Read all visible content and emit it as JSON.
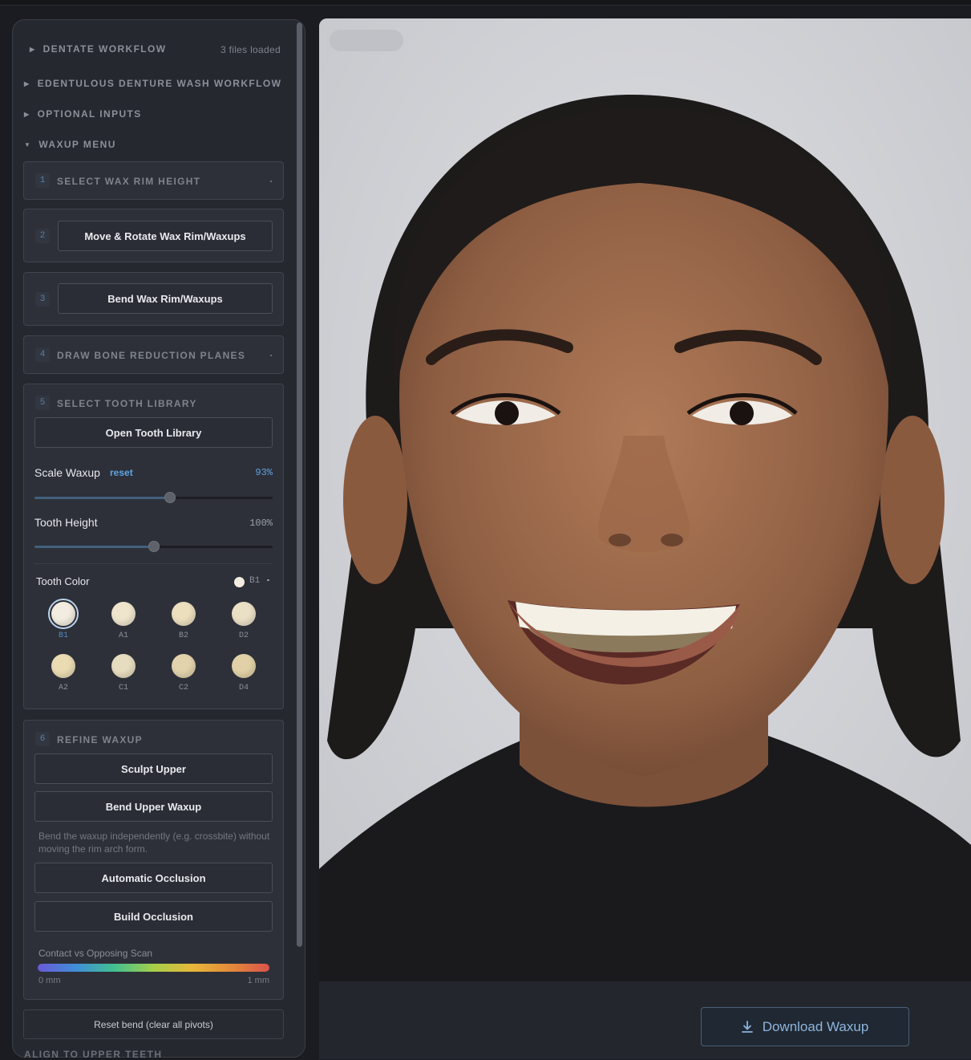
{
  "sidebar": {
    "sections": {
      "dentate": {
        "label": "DENTATE WORKFLOW",
        "meta": "3 files loaded"
      },
      "edentulous": {
        "label": "EDENTULOUS DENTURE WASH WORKFLOW"
      },
      "optional": {
        "label": "OPTIONAL INPUTS"
      },
      "waxup": {
        "label": "WAXUP MENU"
      },
      "align": {
        "label": "ALIGN TO UPPER TEETH"
      }
    },
    "steps": {
      "s1": {
        "num": "1",
        "title": "SELECT WAX RIM HEIGHT"
      },
      "s2": {
        "num": "2",
        "button": "Move & Rotate Wax Rim/Waxups"
      },
      "s3": {
        "num": "3",
        "button": "Bend Wax Rim/Waxups"
      },
      "s4": {
        "num": "4",
        "title": "DRAW BONE REDUCTION PLANES"
      },
      "s5": {
        "num": "5",
        "title": "SELECT TOOTH LIBRARY",
        "button": "Open Tooth Library",
        "scale_label": "Scale Waxup",
        "scale_reset": "reset",
        "scale_value": "93%",
        "scale_fraction": 0.57,
        "height_label": "Tooth Height",
        "height_value": "100%",
        "height_fraction": 0.5,
        "color_label": "Tooth Color",
        "color_selected": "B1",
        "swatches": [
          {
            "label": "B1",
            "color": "#f3ece0"
          },
          {
            "label": "A1",
            "color": "#efe5cd"
          },
          {
            "label": "B2",
            "color": "#ecdfbe"
          },
          {
            "label": "D2",
            "color": "#eae0c6"
          },
          {
            "label": "A2",
            "color": "#eadbb3"
          },
          {
            "label": "C1",
            "color": "#e6dcbf"
          },
          {
            "label": "C2",
            "color": "#e2d3ad"
          },
          {
            "label": "D4",
            "color": "#e2d1a8"
          }
        ]
      },
      "s6": {
        "num": "6",
        "title": "REFINE WAXUP",
        "sculpt": "Sculpt Upper",
        "bend_upper": "Bend Upper Waxup",
        "hint": "Bend the waxup independently (e.g. crossbite) without moving the rim arch form.",
        "auto_occ": "Automatic Occlusion",
        "build_occ": "Build Occlusion",
        "contact_label": "Contact vs Opposing Scan",
        "min_label": "0 mm",
        "max_label": "1 mm"
      }
    },
    "reset_bend": "Reset bend (clear all pivots)"
  },
  "viewer": {
    "download": "Download Waxup",
    "icons": {
      "download": "download-icon"
    }
  },
  "colors": {
    "accent": "#5ea3e6",
    "panel": "#25282f"
  }
}
